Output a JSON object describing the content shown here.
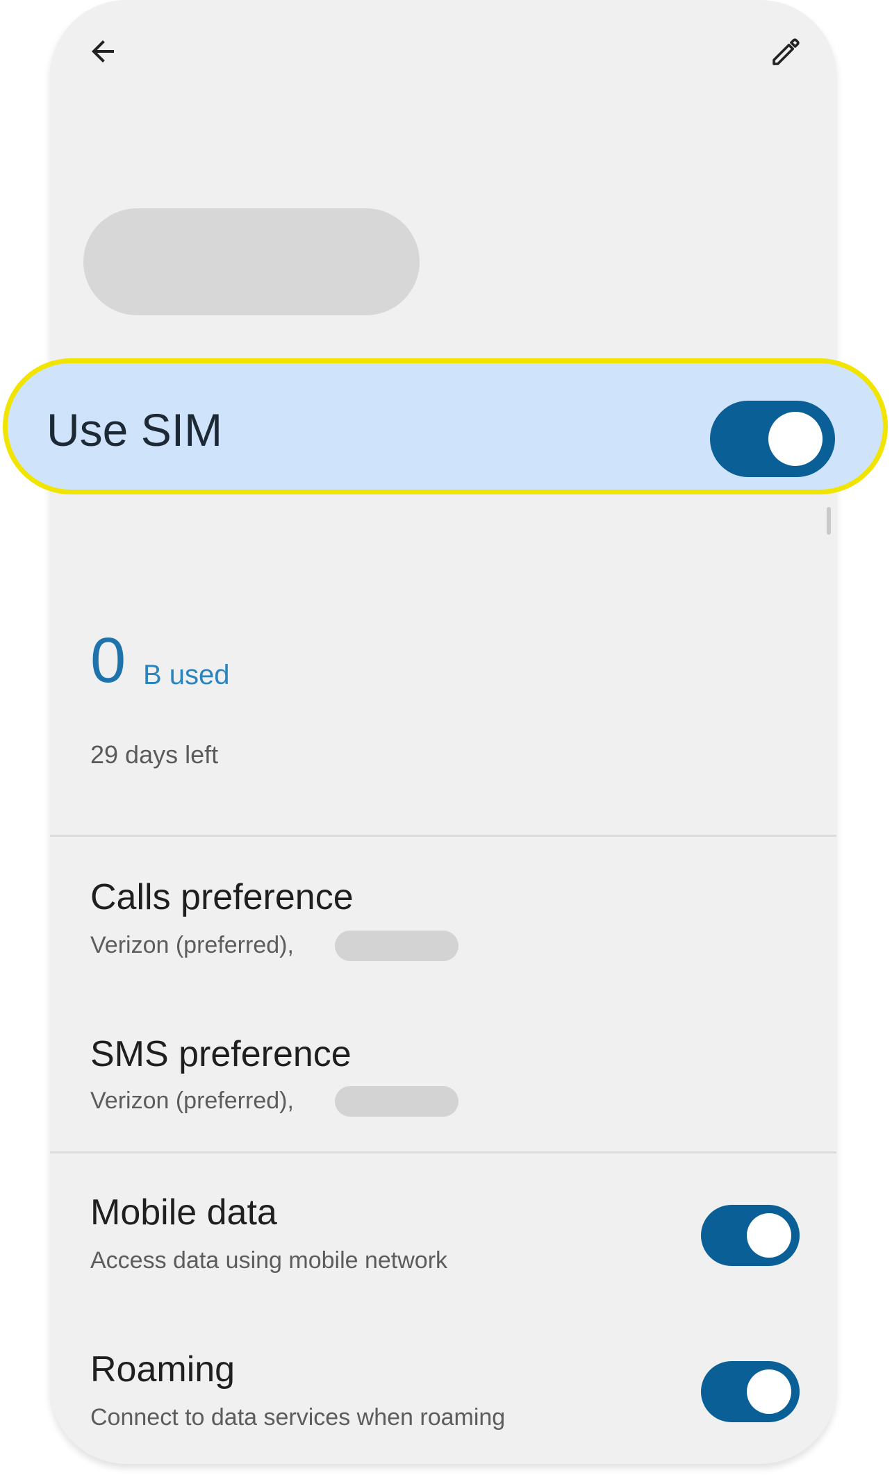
{
  "toolbar": {
    "back_icon": "arrow-back-icon",
    "edit_icon": "pencil-icon"
  },
  "use_sim": {
    "label": "Use SIM",
    "enabled": true
  },
  "usage": {
    "amount": "0",
    "unit": "B used",
    "days_left": "29 days left"
  },
  "preferences": {
    "calls": {
      "title": "Calls preference",
      "subtitle": "Verizon (preferred),"
    },
    "sms": {
      "title": "SMS preference",
      "subtitle": "Verizon (preferred),"
    }
  },
  "network": {
    "mobile_data": {
      "title": "Mobile data",
      "subtitle": "Access data using mobile network",
      "enabled": true
    },
    "roaming": {
      "title": "Roaming",
      "subtitle": "Connect to data services when roaming",
      "enabled": true
    }
  },
  "colors": {
    "accent": "#0a5f96",
    "highlight_fill": "#cfe4fa",
    "highlight_border": "#f0e400",
    "usage_text": "#1f73ad"
  }
}
